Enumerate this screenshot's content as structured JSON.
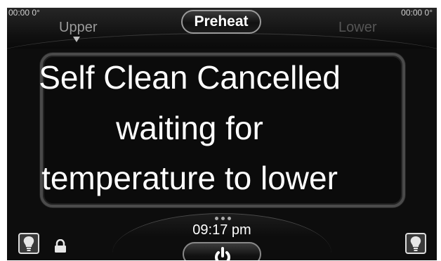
{
  "top": {
    "upper_readout": "00:00  0°",
    "upper_label": "Upper",
    "preheat_label": "Preheat",
    "lower_readout": "00:00   0°",
    "lower_label": "Lower"
  },
  "message": {
    "line1": "Self Clean Cancelled",
    "line2": "waiting for",
    "line3": "temperature to lower"
  },
  "bottom": {
    "clock": "09:17 pm"
  },
  "icons": {
    "light_left": "lightbulb-icon",
    "lock": "lock-icon",
    "power": "power-icon",
    "light_right": "lightbulb-icon"
  }
}
